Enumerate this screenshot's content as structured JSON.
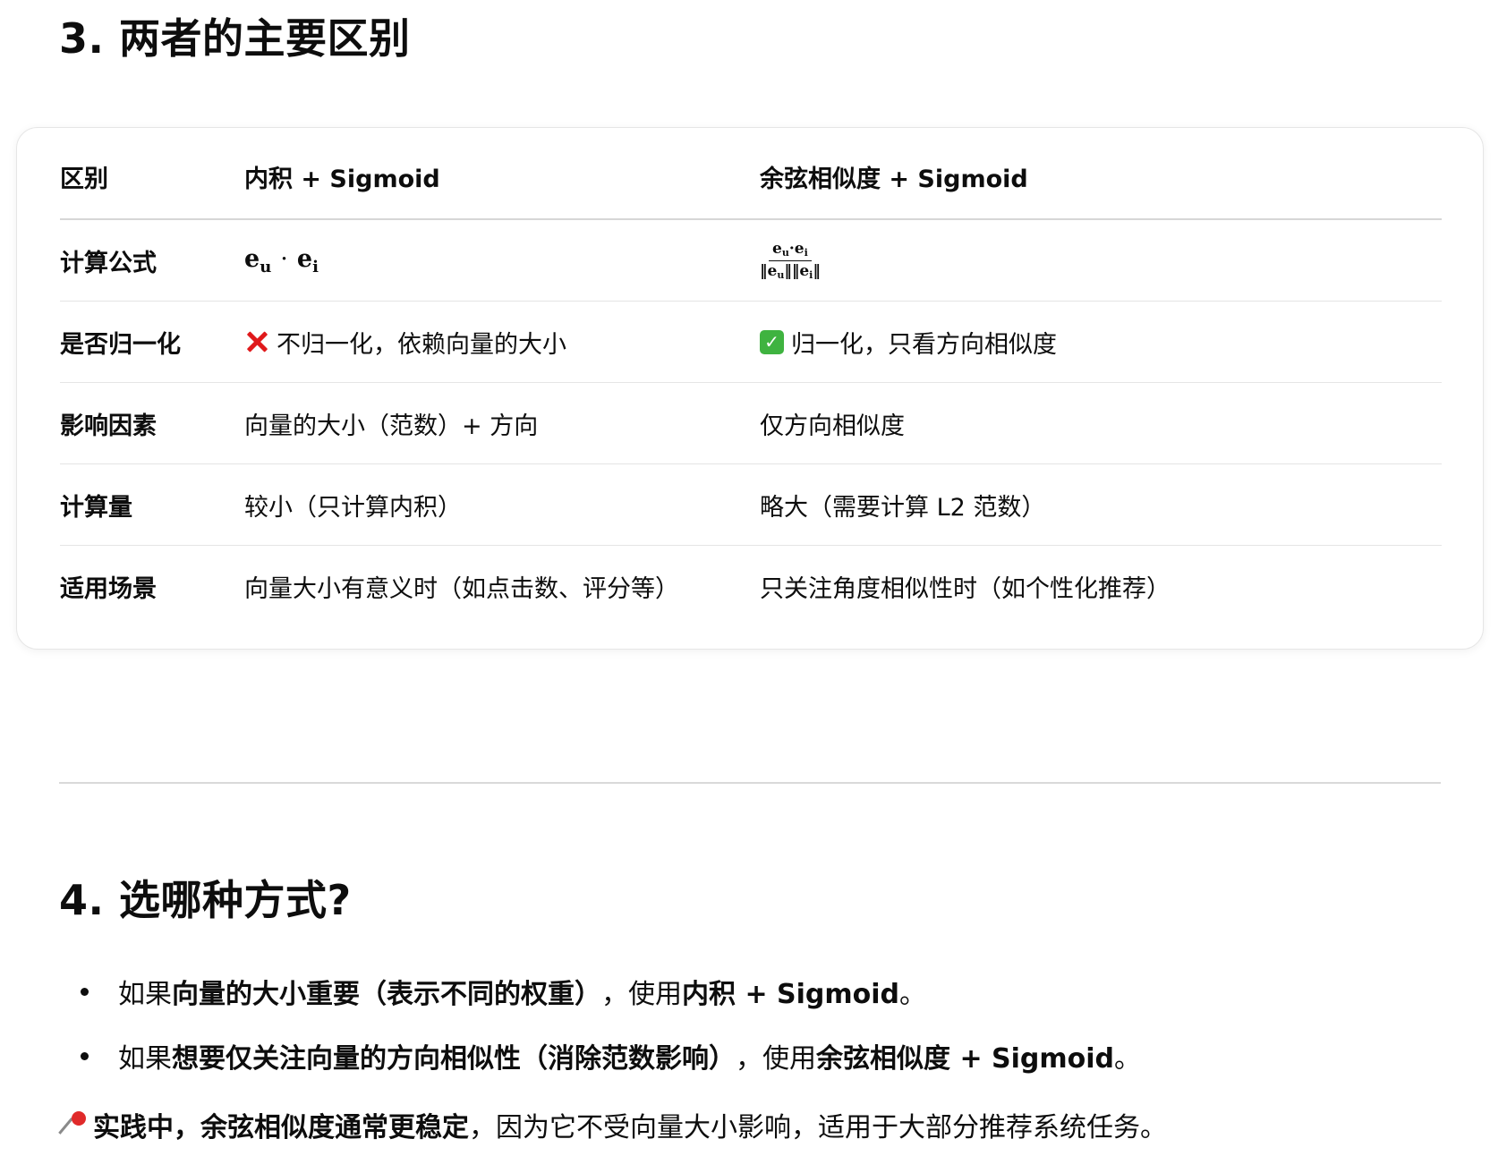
{
  "section3": {
    "title": "3. 两者的主要区别"
  },
  "table": {
    "headers": [
      "区别",
      "内积 + Sigmoid",
      "余弦相似度 + Sigmoid"
    ],
    "rows": [
      {
        "label": "计算公式",
        "inner_product": {
          "a": "e",
          "a_sub": "u",
          "op": "·",
          "b": "e",
          "b_sub": "i"
        },
        "cosine": {
          "num_a": "e",
          "num_a_sub": "u",
          "num_op": "·",
          "num_b": "e",
          "num_b_sub": "i",
          "den_a": "‖e",
          "den_a_sub": "u",
          "den_mid": "‖‖e",
          "den_b_sub": "i",
          "den_end": "‖"
        }
      },
      {
        "label": "是否归一化",
        "inner_product_icon": "cross-mark-icon",
        "inner_product": "不归一化，依赖向量的大小",
        "cosine_icon": "check-mark-button-icon",
        "cosine_icon_glyph": "✓",
        "cosine": "归一化，只看方向相似度"
      },
      {
        "label": "影响因素",
        "inner_product": "向量的大小（范数）+ 方向",
        "cosine": "仅方向相似度"
      },
      {
        "label": "计算量",
        "inner_product": "较小（只计算内积）",
        "cosine": "略大（需要计算 L2 范数）"
      },
      {
        "label": "适用场景",
        "inner_product": "向量大小有意义时（如点击数、评分等）",
        "cosine": "只关注角度相似性时（如个性化推荐）"
      }
    ]
  },
  "section4": {
    "title": "4. 选哪种方式?",
    "bullets": [
      {
        "prefix": "如果",
        "bold1": "向量的大小重要（表示不同的权重）",
        "middle": "，使用 ",
        "bold2": "内积 + Sigmoid",
        "suffix": "。"
      },
      {
        "prefix": "如果",
        "bold1": "想要仅关注向量的方向相似性（消除范数影响）",
        "middle": "，使用 ",
        "bold2": "余弦相似度 + Sigmoid",
        "suffix": "。"
      }
    ],
    "tip": {
      "icon": "pushpin-icon",
      "bold": "实践中，余弦相似度通常更稳定",
      "rest": "，因为它不受向量大小影响，适用于大部分推荐系统任务。"
    }
  },
  "colors": {
    "text": "#0d0d0d",
    "cross": "#e0191b",
    "check": "#3fb340",
    "border": "#e5e5e5"
  }
}
